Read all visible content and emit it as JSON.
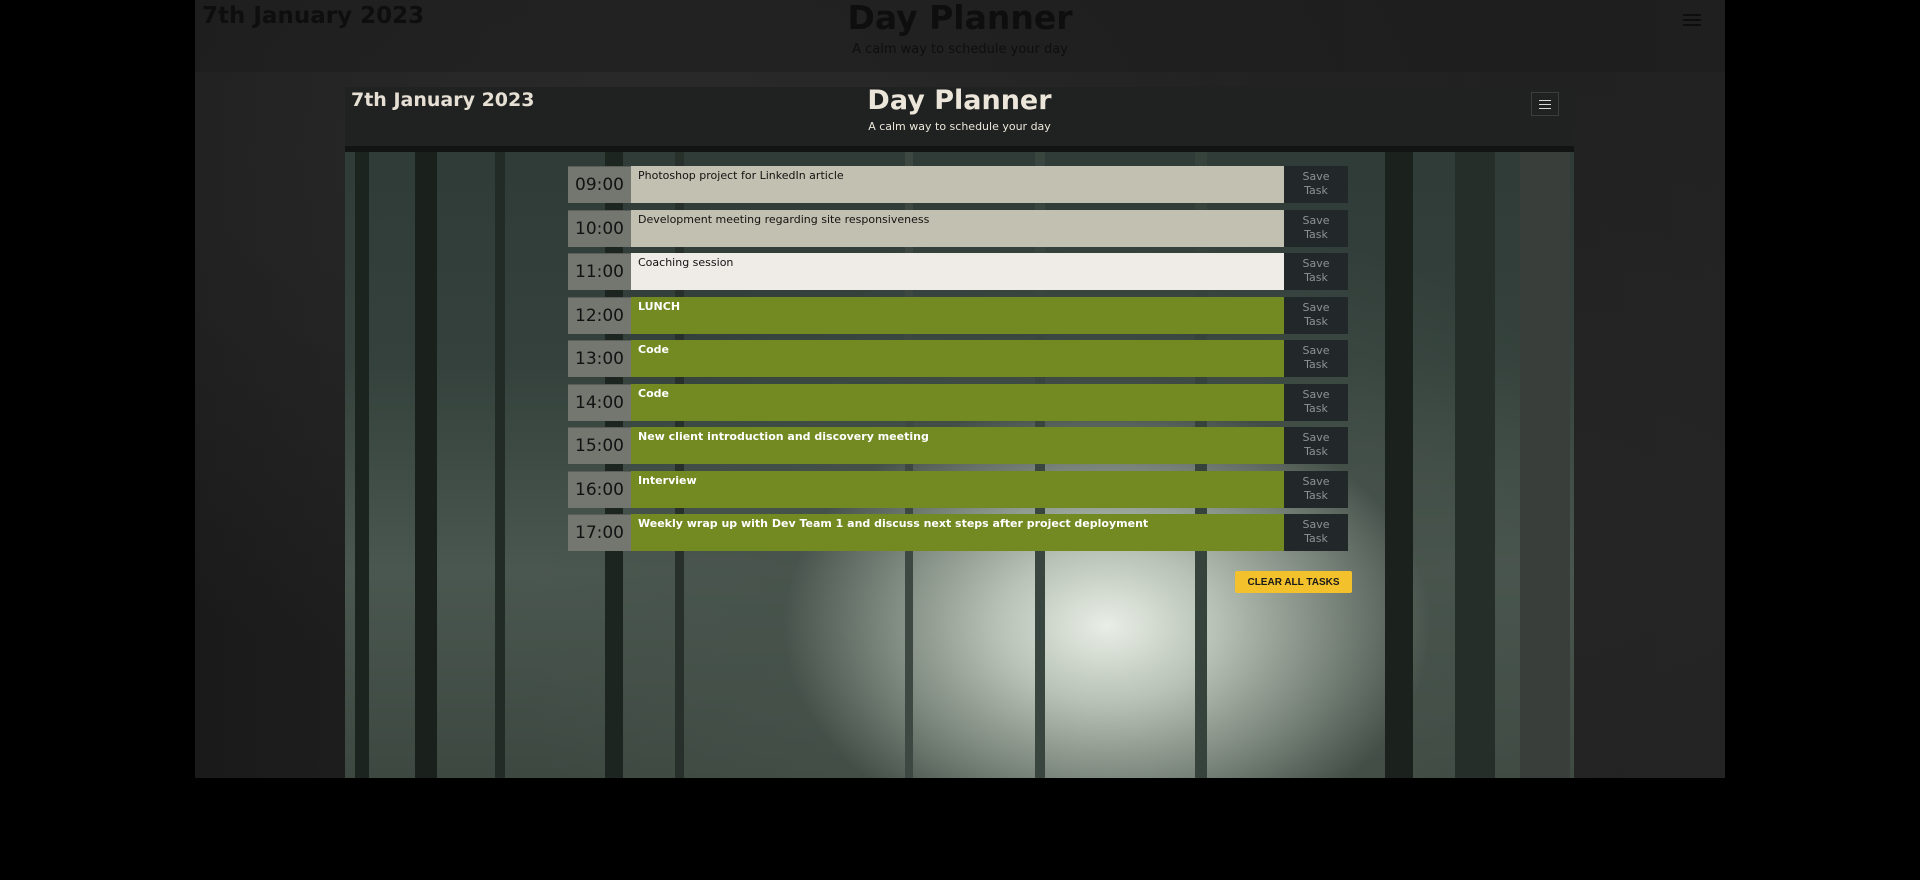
{
  "outer": {
    "date": "7th January 2023",
    "title": "Day Planner",
    "subtitle": "A calm way to schedule your day"
  },
  "app": {
    "date": "7th January 2023",
    "title": "Day Planner",
    "subtitle": "A calm way to schedule your day",
    "menu_icon": "hamburger-icon"
  },
  "colors": {
    "past": "#c2c0b0",
    "present": "#efebe6",
    "future": "#738a23",
    "clear_button": "#f2c12b"
  },
  "timeblocks": [
    {
      "hour": "09:00",
      "task": "Photoshop project for LinkedIn article",
      "state": "past",
      "save": "Save Task"
    },
    {
      "hour": "10:00",
      "task": "Development meeting regarding site responsiveness",
      "state": "past",
      "save": "Save Task"
    },
    {
      "hour": "11:00",
      "task": "Coaching session",
      "state": "present",
      "save": "Save Task"
    },
    {
      "hour": "12:00",
      "task": "LUNCH",
      "state": "future",
      "save": "Save Task"
    },
    {
      "hour": "13:00",
      "task": "Code",
      "state": "future",
      "save": "Save Task"
    },
    {
      "hour": "14:00",
      "task": "Code",
      "state": "future",
      "save": "Save Task"
    },
    {
      "hour": "15:00",
      "task": "New client introduction and discovery meeting",
      "state": "future",
      "save": "Save Task"
    },
    {
      "hour": "16:00",
      "task": "Interview",
      "state": "future",
      "save": "Save Task"
    },
    {
      "hour": "17:00",
      "task": "Weekly wrap up with Dev Team 1 and discuss next steps after project deployment",
      "state": "future",
      "save": "Save Task"
    }
  ],
  "clear_label": "CLEAR ALL TASKS"
}
